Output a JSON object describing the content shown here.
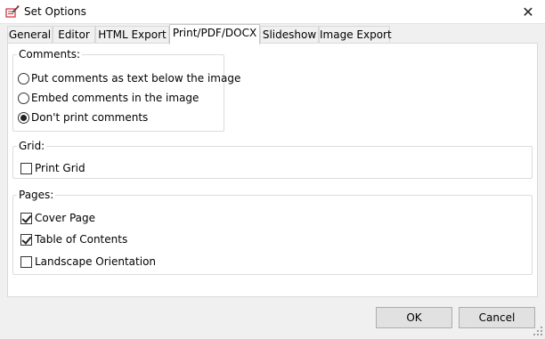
{
  "window": {
    "title": "Set Options",
    "close_glyph": "✕",
    "app_icon": "pencil-sheet-icon"
  },
  "tabs": [
    {
      "label": "General",
      "active": false
    },
    {
      "label": "Editor",
      "active": false
    },
    {
      "label": "HTML Export",
      "active": false
    },
    {
      "label": "Print/PDF/DOCX",
      "active": true
    },
    {
      "label": "Slideshow",
      "active": false
    },
    {
      "label": "Image Export",
      "active": false
    }
  ],
  "comments": {
    "legend": "Comments:",
    "options": [
      {
        "label": "Put comments as text below the image",
        "selected": false
      },
      {
        "label": "Embed comments in the image",
        "selected": false
      },
      {
        "label": "Don't print comments",
        "selected": true
      }
    ]
  },
  "grid": {
    "legend": "Grid:",
    "print_grid": {
      "label": "Print Grid",
      "checked": false
    }
  },
  "pages": {
    "legend": "Pages:",
    "options": [
      {
        "label": "Cover Page",
        "checked": true
      },
      {
        "label": "Table of Contents",
        "checked": true
      },
      {
        "label": "Landscape Orientation",
        "checked": false
      }
    ]
  },
  "buttons": {
    "ok": "OK",
    "cancel": "Cancel"
  },
  "colors": {
    "dialog_bg": "#f0f0f0",
    "panel_bg": "#ffffff",
    "button_bg": "#e1e1e1",
    "icon_red": "#cc2a36"
  }
}
